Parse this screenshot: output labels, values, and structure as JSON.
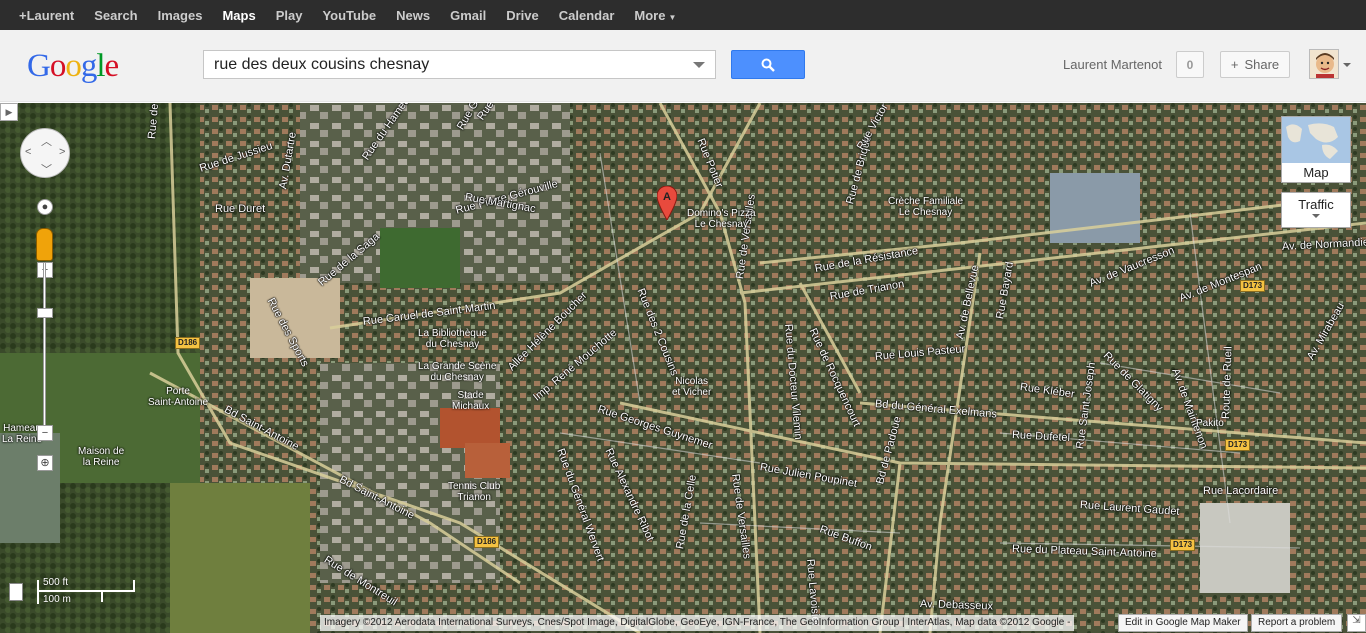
{
  "gbar": {
    "items": [
      {
        "label": "+Laurent",
        "active": false
      },
      {
        "label": "Search",
        "active": false
      },
      {
        "label": "Images",
        "active": false
      },
      {
        "label": "Maps",
        "active": true
      },
      {
        "label": "Play",
        "active": false
      },
      {
        "label": "YouTube",
        "active": false
      },
      {
        "label": "News",
        "active": false
      },
      {
        "label": "Gmail",
        "active": false
      },
      {
        "label": "Drive",
        "active": false
      },
      {
        "label": "Calendar",
        "active": false
      }
    ],
    "more_label": "More"
  },
  "header": {
    "logo_letters": [
      "G",
      "o",
      "o",
      "g",
      "l",
      "e"
    ],
    "search_value": "rue des deux cousins chesnay",
    "user_name": "Laurent Martenot",
    "notification_count": "0",
    "share_label": "Share",
    "search_button_color": "#4d90fe"
  },
  "map": {
    "marker_label": "A",
    "streets": [
      {
        "text": "Rue Caruel de Saint-Martin"
      },
      {
        "text": "Rue des Sports"
      },
      {
        "text": "Bd Saint-Antoine"
      },
      {
        "text": "Bd Saint-Antoine"
      },
      {
        "text": "Rue Pierre Gérouville"
      },
      {
        "text": "Rue Martignac"
      },
      {
        "text": "Rue de Noailles"
      },
      {
        "text": "Rue Potier"
      },
      {
        "text": "Rue des 2 Cousins"
      },
      {
        "text": "Rue de Versailles"
      },
      {
        "text": "Rue de Versailles"
      },
      {
        "text": "Rue de la Résistance"
      },
      {
        "text": "Rue de Trianon"
      },
      {
        "text": "Rue Louis Pasteur"
      },
      {
        "text": "Rue Kléber"
      },
      {
        "text": "Bd du Général Exelmans"
      },
      {
        "text": "Rue Dufetel"
      },
      {
        "text": "Rue Georges Guynemer"
      },
      {
        "text": "Rue Julien Poupinet"
      },
      {
        "text": "Rue Laurent Gaudet"
      },
      {
        "text": "Rue du Plateau Saint-Antoine"
      },
      {
        "text": "Rue Lacordaire"
      },
      {
        "text": "Av. de Vaucresson"
      },
      {
        "text": "Av. de Montespan"
      },
      {
        "text": "Av. de Normandie"
      },
      {
        "text": "Av. Debasseux"
      },
      {
        "text": "Av. de Bellevue"
      },
      {
        "text": "Rue de Glatigny"
      },
      {
        "text": "Allée Hélène Boucher"
      },
      {
        "text": "Imp. René Mouchotte"
      },
      {
        "text": "Rue Buffon"
      },
      {
        "text": "Rue Duret"
      },
      {
        "text": "Av. Dutartre"
      },
      {
        "text": "Rue du Hameau"
      },
      {
        "text": "Rue de la Celle"
      },
      {
        "text": "Rue de Rocquencourt"
      },
      {
        "text": "Rue du Docteur Vilemin"
      },
      {
        "text": "Rue Saint-Joseph"
      },
      {
        "text": "Av. de Maintenon"
      },
      {
        "text": "Rue de Montreuil"
      },
      {
        "text": "Av. Mirabeau"
      },
      {
        "text": "Rue Bayard"
      },
      {
        "text": "Rue de Brique"
      },
      {
        "text": "Route de Rueil"
      },
      {
        "text": "Rue du Général Wervert"
      },
      {
        "text": "Rue Alexandre Ribot"
      },
      {
        "text": "Rue Lavoisier"
      },
      {
        "text": "Bd de Padoue"
      },
      {
        "text": "Rue de Jussieu"
      },
      {
        "text": "Rue de la Saga"
      },
      {
        "text": "Rue Gounod"
      },
      {
        "text": "Rue Victor Hugo"
      },
      {
        "text": "Rue de Saint-Germain"
      }
    ],
    "pois": [
      {
        "text": "La Bibliothèque\ndu Chesnay"
      },
      {
        "text": "La Grande Scène\ndu Chesnay"
      },
      {
        "text": "Stade\nMichaux"
      },
      {
        "text": "Tennis Club\nTrianon"
      },
      {
        "text": "Domino's Pizza\nLe Chesnay"
      },
      {
        "text": "Crèche Familiale\nLe Chesnay"
      },
      {
        "text": "Nicolas\net Vicher"
      },
      {
        "text": "Porte\nSaint-Antoine"
      },
      {
        "text": "Maison de\nla Reine"
      },
      {
        "text": "Hameau\nLa Reine"
      },
      {
        "text": "Pakito"
      }
    ],
    "route_shields": [
      {
        "text": "D186"
      },
      {
        "text": "D186"
      },
      {
        "text": "D173"
      },
      {
        "text": "D173"
      },
      {
        "text": "D173"
      }
    ],
    "scale": {
      "imperial": "500 ft",
      "metric": "100 m"
    }
  },
  "controls": {
    "map_type_label": "Map",
    "traffic_label": "Traffic",
    "zoom_in": "+",
    "zoom_out": "−"
  },
  "footer": {
    "attribution": "Imagery ©2012 Aerodata International Surveys, Cnes/Spot Image, DigitalGlobe, GeoEye, IGN-France, The GeoInformation Group | InterAtlas, Map data ©2012 Google -",
    "edit_label": "Edit in Google Map Maker",
    "report_label": "Report a problem"
  }
}
